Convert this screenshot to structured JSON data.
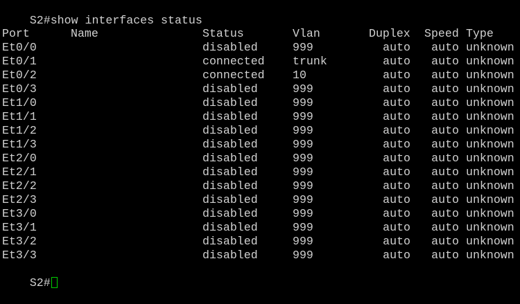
{
  "command_line": "S2#show interfaces status",
  "prompt": "S2#",
  "colors": {
    "background": "#000000",
    "text": "#d0d0d0",
    "cursor": "#00d000"
  },
  "table": {
    "headers": {
      "port": "Port",
      "name": "Name",
      "status": "Status",
      "vlan": "Vlan",
      "duplex": "Duplex",
      "speed": "Speed",
      "type": "Type"
    },
    "rows": [
      {
        "port": "Et0/0",
        "name": "",
        "status": "disabled",
        "vlan": "999",
        "duplex": "auto",
        "speed": "auto",
        "type": "unknown"
      },
      {
        "port": "Et0/1",
        "name": "",
        "status": "connected",
        "vlan": "trunk",
        "duplex": "auto",
        "speed": "auto",
        "type": "unknown"
      },
      {
        "port": "Et0/2",
        "name": "",
        "status": "connected",
        "vlan": "10",
        "duplex": "auto",
        "speed": "auto",
        "type": "unknown"
      },
      {
        "port": "Et0/3",
        "name": "",
        "status": "disabled",
        "vlan": "999",
        "duplex": "auto",
        "speed": "auto",
        "type": "unknown"
      },
      {
        "port": "Et1/0",
        "name": "",
        "status": "disabled",
        "vlan": "999",
        "duplex": "auto",
        "speed": "auto",
        "type": "unknown"
      },
      {
        "port": "Et1/1",
        "name": "",
        "status": "disabled",
        "vlan": "999",
        "duplex": "auto",
        "speed": "auto",
        "type": "unknown"
      },
      {
        "port": "Et1/2",
        "name": "",
        "status": "disabled",
        "vlan": "999",
        "duplex": "auto",
        "speed": "auto",
        "type": "unknown"
      },
      {
        "port": "Et1/3",
        "name": "",
        "status": "disabled",
        "vlan": "999",
        "duplex": "auto",
        "speed": "auto",
        "type": "unknown"
      },
      {
        "port": "Et2/0",
        "name": "",
        "status": "disabled",
        "vlan": "999",
        "duplex": "auto",
        "speed": "auto",
        "type": "unknown"
      },
      {
        "port": "Et2/1",
        "name": "",
        "status": "disabled",
        "vlan": "999",
        "duplex": "auto",
        "speed": "auto",
        "type": "unknown"
      },
      {
        "port": "Et2/2",
        "name": "",
        "status": "disabled",
        "vlan": "999",
        "duplex": "auto",
        "speed": "auto",
        "type": "unknown"
      },
      {
        "port": "Et2/3",
        "name": "",
        "status": "disabled",
        "vlan": "999",
        "duplex": "auto",
        "speed": "auto",
        "type": "unknown"
      },
      {
        "port": "Et3/0",
        "name": "",
        "status": "disabled",
        "vlan": "999",
        "duplex": "auto",
        "speed": "auto",
        "type": "unknown"
      },
      {
        "port": "Et3/1",
        "name": "",
        "status": "disabled",
        "vlan": "999",
        "duplex": "auto",
        "speed": "auto",
        "type": "unknown"
      },
      {
        "port": "Et3/2",
        "name": "",
        "status": "disabled",
        "vlan": "999",
        "duplex": "auto",
        "speed": "auto",
        "type": "unknown"
      },
      {
        "port": "Et3/3",
        "name": "",
        "status": "disabled",
        "vlan": "999",
        "duplex": "auto",
        "speed": "auto",
        "type": "unknown"
      }
    ]
  }
}
